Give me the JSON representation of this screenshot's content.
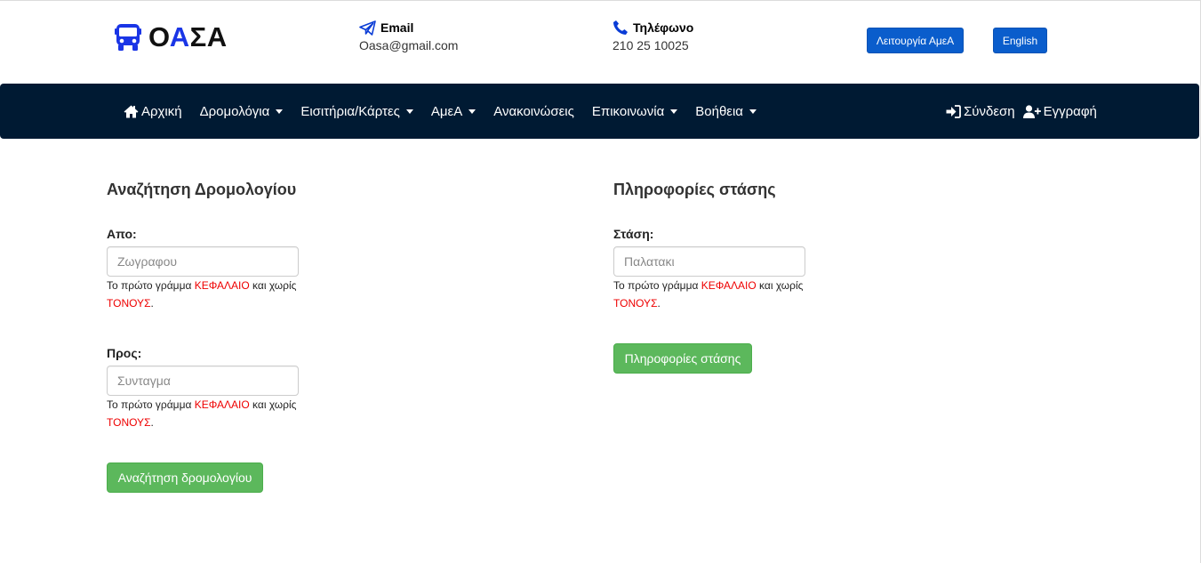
{
  "header": {
    "logo_text_1": "Ο",
    "logo_text_2": "Α",
    "logo_text_3": "ΣΑ",
    "email_label": "Email",
    "email_value": "Oasa@gmail.com",
    "phone_label": "Τηλέφωνο",
    "phone_value": "210 25 10025",
    "amea_button": "Λειτουργία ΑμεΑ",
    "english_button": "English"
  },
  "nav": {
    "home": "Αρχική",
    "routes": "Δρομολόγια",
    "tickets": "Εισιτήρια/Κάρτες",
    "amea": "ΑμεΑ",
    "announcements": "Ανακοινώσεις",
    "contact": "Επικοινωνία",
    "help": "Βοήθεια",
    "login": "Σύνδεση",
    "register": "Εγγραφή"
  },
  "route_search": {
    "title": "Αναζήτηση Δρομολογίου",
    "from_label": "Απο:",
    "from_placeholder": "Ζωγραφου",
    "to_label": "Προς:",
    "to_placeholder": "Συνταγμα",
    "hint_prefix": "Το πρώτο γράμμα ",
    "hint_caps": "ΚΕΦΑΛΑΙΟ",
    "hint_mid": " και χωρίς ",
    "hint_accents": "ΤΟΝΟΥΣ",
    "hint_end": ".",
    "submit": "Αναζήτηση δρομολογίου"
  },
  "stop_info": {
    "title": "Πληροφορίες στάσης",
    "stop_label": "Στάση:",
    "stop_placeholder": "Παλατακι",
    "submit": "Πληροφορίες στάσης"
  },
  "colors": {
    "navbar": "#001a33",
    "primary_button": "#0a5dcc",
    "success_button": "#5cb85c",
    "logo_accent": "#1a35e6",
    "hint_highlight": "#ee0000"
  }
}
